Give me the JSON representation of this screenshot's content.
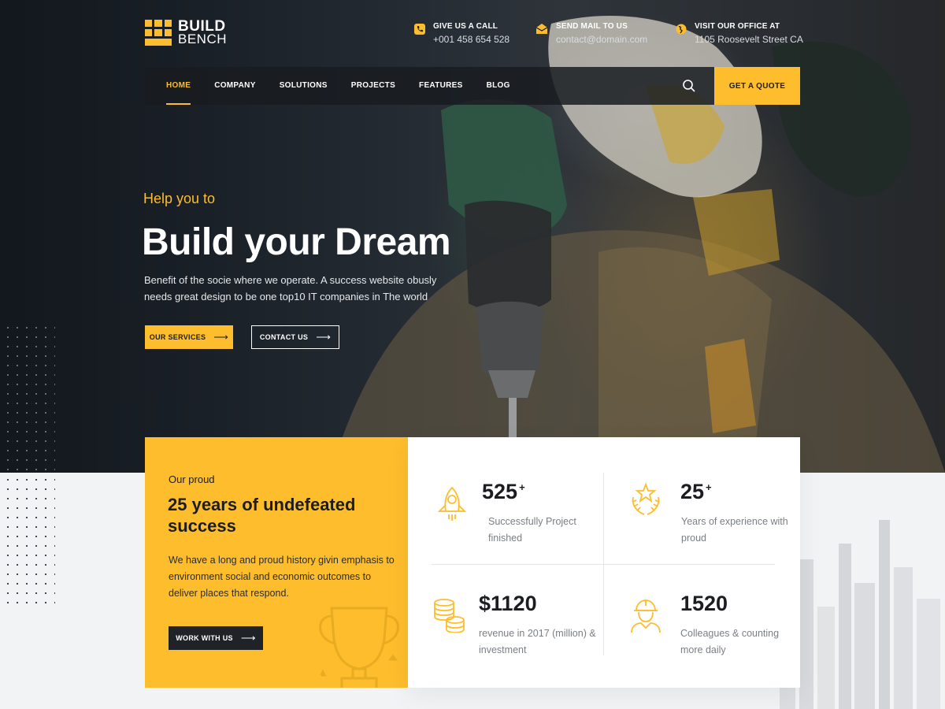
{
  "brand": {
    "line1": "BUILD",
    "line2": "BENCH",
    "accent_color": "#fdbd2c"
  },
  "contacts": [
    {
      "icon": "phone-icon",
      "title": "GIVE US A CALL",
      "value": "+001 458 654 528"
    },
    {
      "icon": "mail-icon",
      "title": "SEND MAIL TO US",
      "value": "contact@domain.com"
    },
    {
      "icon": "globe-icon",
      "title": "VISIT OUR OFFICE AT",
      "value": "1105 Roosevelt Street CA"
    }
  ],
  "nav": {
    "items": [
      {
        "label": "HOME",
        "active": true
      },
      {
        "label": "COMPANY",
        "active": false
      },
      {
        "label": "SOLUTIONS",
        "active": false
      },
      {
        "label": "PROJECTS",
        "active": false
      },
      {
        "label": "FEATURES",
        "active": false
      },
      {
        "label": "BLOG",
        "active": false
      }
    ],
    "search_icon": "search-icon",
    "cta": "GET A QUOTE"
  },
  "hero": {
    "kicker": "Help you to",
    "title": "Build your Dream",
    "subtitle": "Benefit of the socie where we operate. A success website obusly needs great design to be one top10 IT companies in The world",
    "primary_button": "OUR SERVICES",
    "secondary_button": "CONTACT US"
  },
  "about": {
    "kicker": "Our proud",
    "title": "25 years of undefeated success",
    "text": "We have a long and proud history givin emphasis to environment social and economic outcomes to deliver places that respond.",
    "button": "WORK WITH US"
  },
  "stats": [
    {
      "icon": "rocket-icon",
      "value": "525",
      "suffix": "+",
      "label": "Successfully Project finished"
    },
    {
      "icon": "star-laurel-icon",
      "value": "25",
      "suffix": "+",
      "label": "Years of experience with proud"
    },
    {
      "icon": "coins-icon",
      "value": "$1120",
      "suffix": "",
      "label": "revenue in 2017 (million) & investment"
    },
    {
      "icon": "worker-icon",
      "value": "1520",
      "suffix": "",
      "label": "Colleagues & counting more daily"
    }
  ]
}
